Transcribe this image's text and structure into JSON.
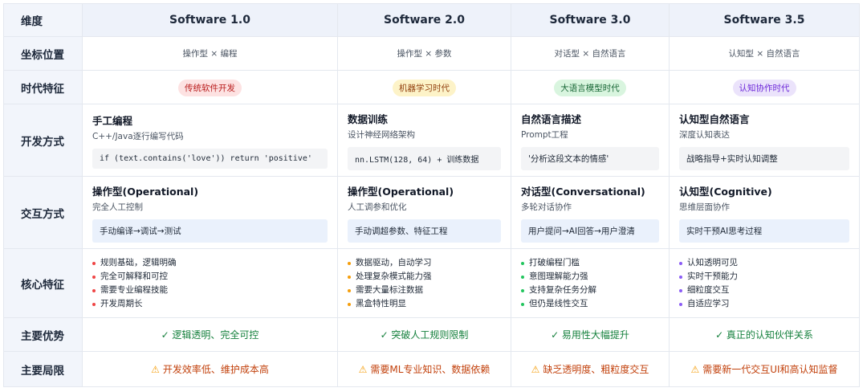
{
  "header": {
    "dimension_label": "维度",
    "columns": [
      "Software 1.0",
      "Software 2.0",
      "Software 3.0",
      "Software 3.5"
    ]
  },
  "rows": {
    "coord": {
      "label": "坐标位置",
      "values": [
        "操作型 × 编程",
        "操作型 × 参数",
        "对话型 × 自然语言",
        "认知型 × 自然语言"
      ]
    },
    "era": {
      "label": "时代特征",
      "values": [
        "传统软件开发",
        "机器学习时代",
        "大语言模型时代",
        "认知协作时代"
      ],
      "colors": [
        "#fde2e2",
        "#fdf3c8",
        "#d9f5df",
        "#ebe3fb"
      ]
    },
    "dev": {
      "label": "开发方式",
      "cells": [
        {
          "title": "手工编程",
          "sub": "C++/Java逐行编写代码",
          "code": "if (text.contains('love')) return 'positive'"
        },
        {
          "title": "数据训练",
          "sub": "设计神经网络架构",
          "code": "nn.LSTM(128, 64) + 训练数据"
        },
        {
          "title": "自然语言描述",
          "sub": "Prompt工程",
          "code": "'分析这段文本的情感'"
        },
        {
          "title": "认知型自然语言",
          "sub": "深度认知表达",
          "code": "战略指导+实时认知调整"
        }
      ]
    },
    "inter": {
      "label": "交互方式",
      "cells": [
        {
          "title": "操作型(Operational)",
          "sub": "完全人工控制",
          "box": "手动编译→调试→测试"
        },
        {
          "title": "操作型(Operational)",
          "sub": "人工调参和优化",
          "box": "手动调超参数、特征工程"
        },
        {
          "title": "对话型(Conversational)",
          "sub": "多轮对话协作",
          "box": "用户提问→AI回答→用户澄清"
        },
        {
          "title": "认知型(Cognitive)",
          "sub": "思维层面协作",
          "box": "实时干预AI思考过程"
        }
      ]
    },
    "feat": {
      "label": "核心特征",
      "cells": [
        {
          "items": [
            "规则基础，逻辑明确",
            "完全可解释和可控",
            "需要专业编程技能",
            "开发周期长"
          ],
          "dot": "#ef4444"
        },
        {
          "items": [
            "数据驱动，自动学习",
            "处理复杂模式能力强",
            "需要大量标注数据",
            "黑盒特性明显"
          ],
          "dot": "#f59e0b"
        },
        {
          "items": [
            "打破编程门槛",
            "意图理解能力强",
            "支持复杂任务分解",
            "但仍是线性交互"
          ],
          "dot": "#22c55e"
        },
        {
          "items": [
            "认知透明可见",
            "实时干预能力",
            "细粒度交互",
            "自适应学习"
          ],
          "dot": "#8b5cf6"
        }
      ]
    },
    "adv": {
      "label": "主要优势",
      "values": [
        "✓ 逻辑透明、完全可控",
        "✓ 突破人工规则限制",
        "✓ 易用性大幅提升",
        "✓ 真正的认知伙伴关系"
      ]
    },
    "lim": {
      "label": "主要局限",
      "values": [
        "开发效率低、维护成本高",
        "需要ML专业知识、数据依赖",
        "缺乏透明度、粗粒度交互",
        "需要新一代交互UI和高认知监督"
      ],
      "icon": "warning-icon"
    }
  }
}
